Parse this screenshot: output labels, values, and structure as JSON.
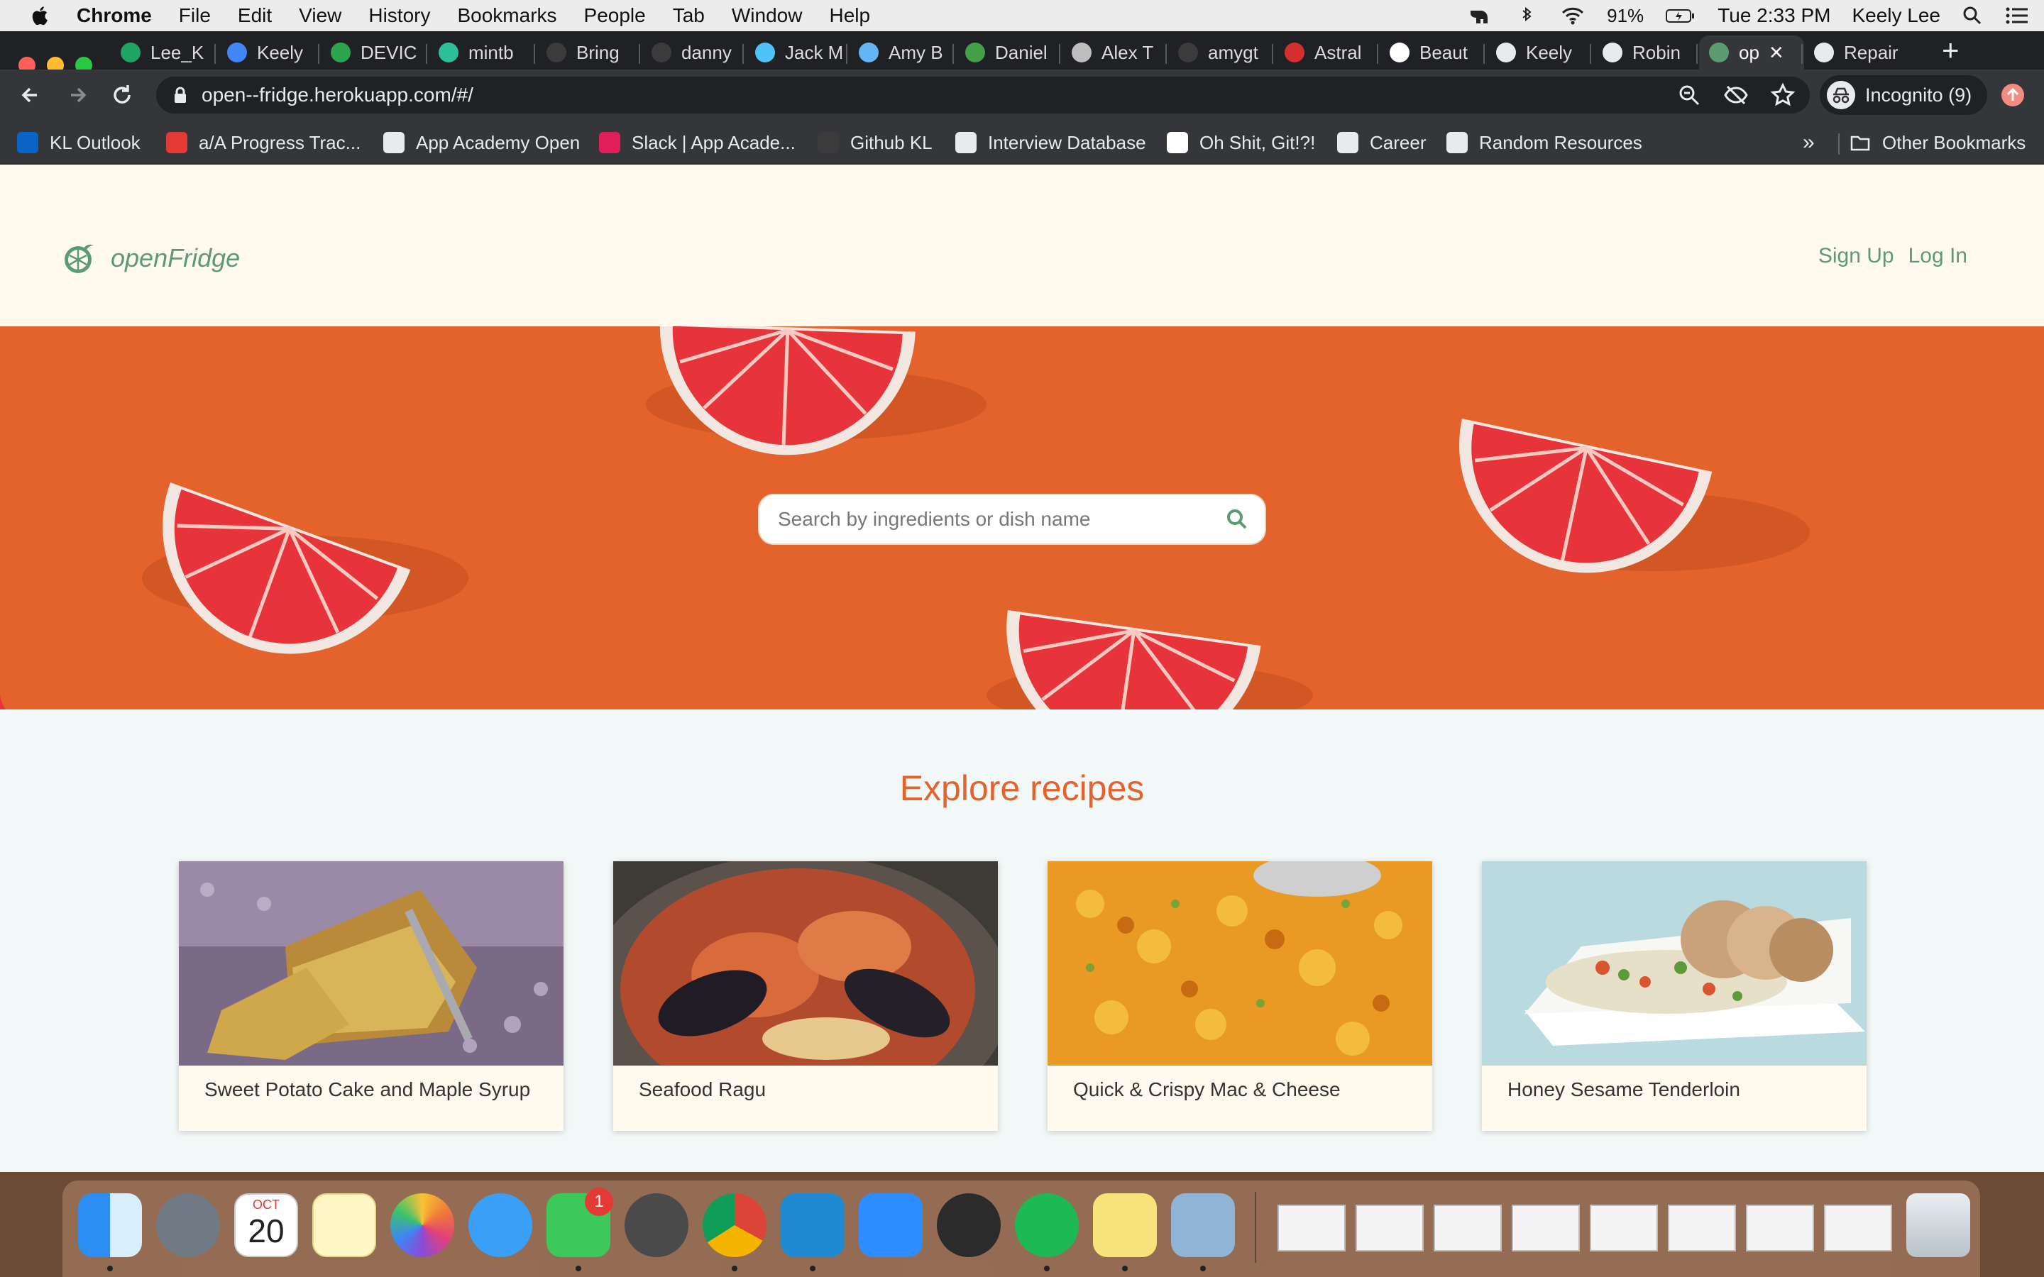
{
  "menubar": {
    "app_name": "Chrome",
    "items": [
      "File",
      "Edit",
      "View",
      "History",
      "Bookmarks",
      "People",
      "Tab",
      "Window",
      "Help"
    ],
    "battery": "91%",
    "clock": "Tue 2:33 PM",
    "user": "Keely Lee"
  },
  "tabs": [
    {
      "label": "Lee_K",
      "icon": "google-drive-icon",
      "color": "#1fa463"
    },
    {
      "label": "Keely",
      "icon": "google-docs-icon",
      "color": "#4285f4"
    },
    {
      "label": "DEVIC",
      "icon": "shield-icon",
      "color": "#2ea44f"
    },
    {
      "label": "mintb",
      "icon": "mint-icon",
      "color": "#2dbe9a"
    },
    {
      "label": "Bring",
      "icon": "github-icon",
      "color": "#3b3b3b"
    },
    {
      "label": "danny",
      "icon": "github-icon",
      "color": "#3b3b3b"
    },
    {
      "label": "Jack M",
      "icon": "jm-logo-icon",
      "color": "#4fc3f7"
    },
    {
      "label": "Amy B",
      "icon": "ab-logo-icon",
      "color": "#64b5f6"
    },
    {
      "label": "Daniel",
      "icon": "leaf-icon",
      "color": "#43a047"
    },
    {
      "label": "Alex T",
      "icon": "plane-icon",
      "color": "#bdbdbd"
    },
    {
      "label": "amygt",
      "icon": "github-icon",
      "color": "#3b3b3b"
    },
    {
      "label": "Astral",
      "icon": "hsu-icon",
      "color": "#d32f2f"
    },
    {
      "label": "Beaut",
      "icon": "beaut-icon",
      "color": "#ffffff"
    },
    {
      "label": "Keely",
      "icon": "globe-icon",
      "color": "#e8eaed"
    },
    {
      "label": "Robin",
      "icon": "globe-icon",
      "color": "#e8eaed"
    },
    {
      "label": "op",
      "icon": "openfridge-icon",
      "color": "#5c9b72"
    },
    {
      "label": "Repair",
      "icon": "globe-icon",
      "color": "#e8eaed"
    }
  ],
  "omnibox": {
    "url": "open--fridge.herokuapp.com/#/",
    "incognito_label": "Incognito (9)"
  },
  "bookmarks": [
    {
      "label": "KL Outlook",
      "icon": "outlook-icon",
      "color": "#0a64c8"
    },
    {
      "label": "a/A Progress Trac...",
      "icon": "aa-icon",
      "color": "#e53935"
    },
    {
      "label": "App Academy Open",
      "icon": "globe-icon",
      "color": "#e8eaed"
    },
    {
      "label": "Slack | App Acade...",
      "icon": "slack-icon",
      "color": "#e01e5a"
    },
    {
      "label": "Github KL",
      "icon": "github-icon",
      "color": "#3b3b3b"
    },
    {
      "label": "Interview Database",
      "icon": "globe-icon",
      "color": "#e8eaed"
    },
    {
      "label": "Oh Shit, Git!?!",
      "icon": "question-box-icon",
      "color": "#ffffff"
    },
    {
      "label": "Career",
      "icon": "folder-icon",
      "color": "#e8eaed"
    },
    {
      "label": "Random Resources",
      "icon": "folder-icon",
      "color": "#e8eaed"
    }
  ],
  "bookmarks_overflow": "»",
  "other_bookmarks": "Other Bookmarks",
  "site": {
    "brand": "openFridge",
    "nav": {
      "signup": "Sign Up",
      "login": "Log In"
    },
    "search_placeholder": "Search by ingredients or dish name",
    "section_title": "Explore recipes",
    "recipes": [
      {
        "title": "Sweet Potato Cake and Maple Syrup"
      },
      {
        "title": "Seafood Ragu"
      },
      {
        "title": "Quick & Crispy Mac & Cheese"
      },
      {
        "title": "Honey Sesame Tenderloin"
      }
    ]
  },
  "dock": {
    "calendar_month": "OCT",
    "calendar_day": "20",
    "facetime_badge": "1"
  },
  "colors": {
    "accent_green": "#5c9b72",
    "accent_orange": "#e4632d",
    "header_cream": "#fffaed"
  }
}
